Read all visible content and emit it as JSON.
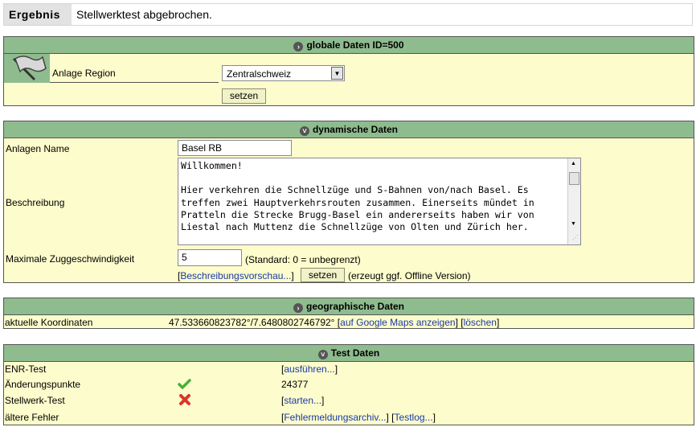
{
  "result": {
    "label": "Ergebnis",
    "message": "Stellwerktest abgebrochen."
  },
  "global": {
    "header": "globale Daten ID=500",
    "region_label": "Anlage Region",
    "region_value": "Zentralschweiz",
    "set_button": "setzen"
  },
  "dynamic": {
    "header": "dynamische Daten",
    "name_label": "Anlagen Name",
    "name_value": "Basel RB",
    "desc_label": "Beschreibung",
    "desc_value": "Willkommen!\n\nHier verkehren die Schnellzüge und S-Bahnen von/nach Basel. Es treffen zwei Hauptverkehrsrouten zusammen. Einerseits mündet in Pratteln die Strecke Brugg-Basel ein andererseits haben wir von Liestal nach Muttenz die Schnellzüge von Olten und Zürich her.",
    "speed_label": "Maximale Zuggeschwindigkeit",
    "speed_value": "5",
    "speed_hint": "(Standard: 0 = unbegrenzt)",
    "preview_link": "Beschreibungsvorschau...",
    "set_button": "setzen",
    "offline_hint": "(erzeugt ggf. Offline Version)"
  },
  "geo": {
    "header": "geographische Daten",
    "coord_label": "aktuelle Koordinaten",
    "coord_value": "47.533660823782°/7.6480802746792°",
    "maps_link": "auf Google Maps anzeigen",
    "delete_link": "löschen"
  },
  "test": {
    "header": "Test Daten",
    "enr_label": "ENR-Test",
    "enr_link": "ausführen...",
    "change_label": "Änderungspunkte",
    "change_value": "24377",
    "stellwerk_label": "Stellwerk-Test",
    "stellwerk_link": "starten...",
    "errors_label": "ältere Fehler",
    "archive_link": "Fehlermeldungsarchiv...",
    "testlog_link": "Testlog..."
  },
  "icons": {
    "check": "check-icon",
    "cross": "cross-icon",
    "flag": "flag-icon"
  },
  "colors": {
    "header_bg": "#8fbc8f",
    "panel_bg": "#fcfccc",
    "link": "#1a3aa8",
    "check": "#4caf3a",
    "cross": "#d9362b"
  }
}
